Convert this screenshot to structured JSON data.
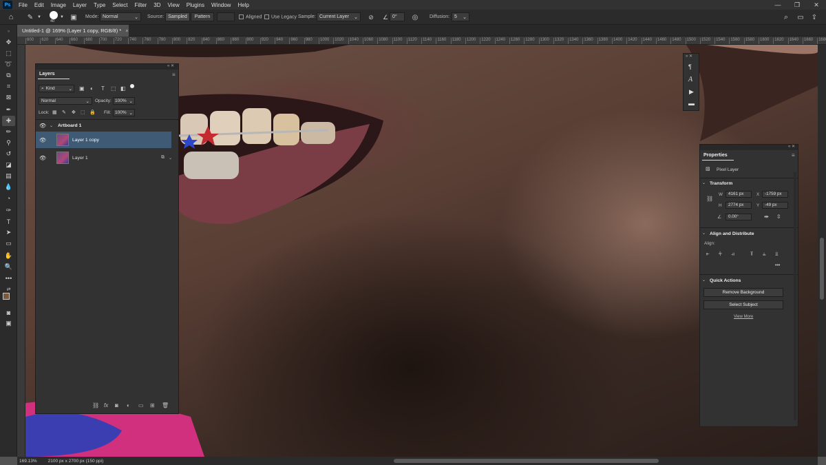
{
  "menubar": {
    "logo": "Ps",
    "items": [
      "File",
      "Edit",
      "Image",
      "Layer",
      "Type",
      "Select",
      "Filter",
      "3D",
      "View",
      "Plugins",
      "Window",
      "Help"
    ],
    "window_controls": [
      "—",
      "❐",
      "✕"
    ]
  },
  "options": {
    "brush_size": "40",
    "mode_label": "Mode:",
    "mode_value": "Normal",
    "source_label": "Source:",
    "source_sampled": "Sampled",
    "source_pattern": "Pattern",
    "aligned_label": "Aligned",
    "legacy_label": "Use Legacy",
    "sample_label": "Sample:",
    "sample_value": "Current Layer",
    "angle_value": "0°",
    "diffusion_label": "Diffusion:",
    "diffusion_value": "5"
  },
  "document_tab": {
    "title": "Untitled-1 @ 169% (Layer 1 copy, RGB/8) *",
    "close": "×"
  },
  "ruler_ticks": [
    "600",
    "620",
    "640",
    "660",
    "680",
    "700",
    "720",
    "740",
    "760",
    "780",
    "800",
    "820",
    "840",
    "860",
    "880",
    "900",
    "920",
    "940",
    "960",
    "980",
    "1000",
    "1020",
    "1040",
    "1060",
    "1080",
    "1100",
    "1120",
    "1140",
    "1160",
    "1180",
    "1200",
    "1220",
    "1240",
    "1260",
    "1280",
    "1300",
    "1320",
    "1340",
    "1360",
    "1380",
    "1400",
    "1420",
    "1440",
    "1460",
    "1480",
    "1500",
    "1520",
    "1540",
    "1560",
    "1580",
    "1600",
    "1620",
    "1640",
    "1660",
    "1680"
  ],
  "layers_panel": {
    "title": "Layers",
    "filter_kind": "Kind",
    "blend_mode": "Normal",
    "opacity_label": "Opacity:",
    "opacity_value": "100%",
    "lock_label": "Lock:",
    "fill_label": "Fill:",
    "fill_value": "100%",
    "layers": [
      {
        "name": "Artboard 1"
      },
      {
        "name": "Layer 1 copy",
        "selected": true
      },
      {
        "name": "Layer 1"
      }
    ]
  },
  "properties_panel": {
    "title": "Properties",
    "layer_type": "Pixel Layer",
    "transform_label": "Transform",
    "w_label": "W",
    "w_value": "4161 px",
    "x_label": "X",
    "x_value": "-1759 px",
    "h_label": "H",
    "h_value": "2774 px",
    "y_label": "Y",
    "y_value": "-49 px",
    "angle_value": "0.00°",
    "align_distribute": "Align and Distribute",
    "align_label": "Align:",
    "more": "•••",
    "quick_actions": "Quick Actions",
    "remove_bg": "Remove Background",
    "select_subject": "Select Subject",
    "view_more": "View More"
  },
  "status": {
    "zoom": "169.13%",
    "doc_size": "2100 px x 2700 px (150 ppi)"
  },
  "colors": {
    "foreground": "#7a5a3c",
    "background": "#ffffff",
    "selected_layer": "#3f5a75"
  }
}
